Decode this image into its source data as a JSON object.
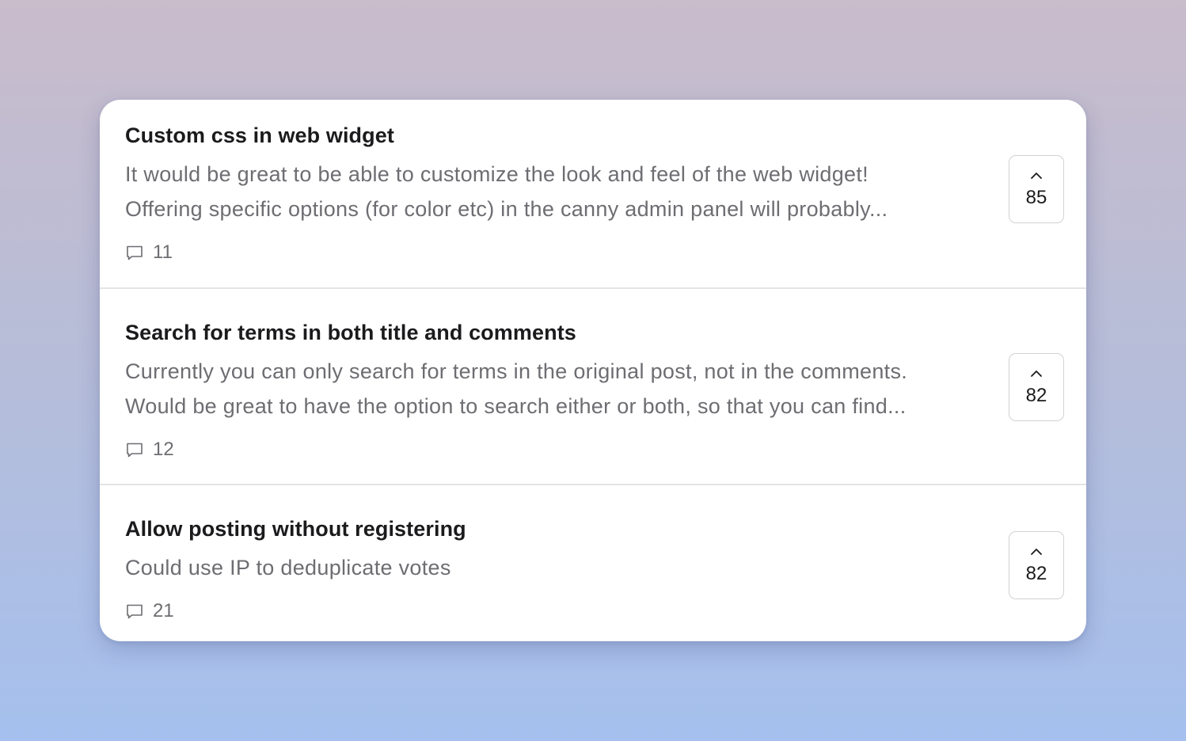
{
  "posts": [
    {
      "title": "Custom css in web widget",
      "description_lines": [
        "It would be great to be able to customize the look and feel of the web widget!",
        "Offering specific options (for color etc) in the canny admin panel will probably..."
      ],
      "comment_count": "11",
      "vote_count": "85"
    },
    {
      "title": "Search for terms in both title and comments",
      "description_lines": [
        "Currently you can only search for terms in the original post, not in the comments.",
        "Would be great to have the option to search either or both, so that you can find..."
      ],
      "comment_count": "12",
      "vote_count": "82"
    },
    {
      "title": "Allow posting without registering",
      "description_lines": [
        "Could use IP to deduplicate votes"
      ],
      "comment_count": "21",
      "vote_count": "82"
    }
  ],
  "icons": {
    "comment": "comment-bubble-icon",
    "upvote": "chevron-up-icon"
  },
  "colors": {
    "title": "#1b1b1d",
    "muted_text": "#6d6d72",
    "divider": "#e4e4e6",
    "vote_border": "#d2d2d6",
    "card": "#ffffff"
  }
}
